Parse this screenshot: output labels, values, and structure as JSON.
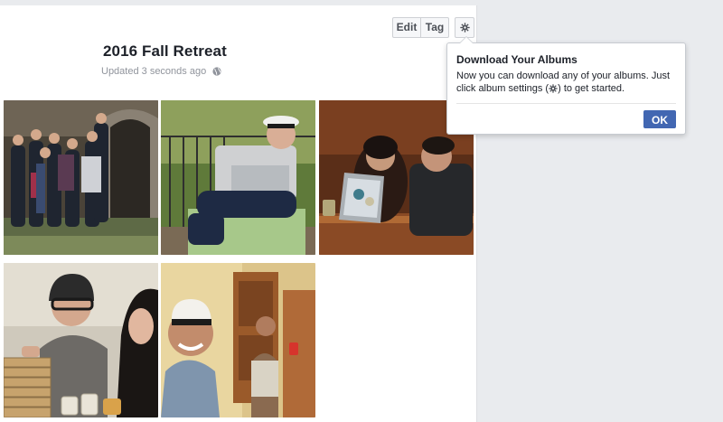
{
  "toolbar": {
    "edit_label": "Edit",
    "tag_label": "Tag",
    "settings_icon": "gear-icon"
  },
  "album": {
    "title": "2016 Fall Retreat",
    "updated": "Updated 3 seconds ago",
    "privacy_icon": "globe-icon"
  },
  "photos": [
    {
      "scene": "group-posing-outdoors"
    },
    {
      "scene": "man-in-captain-hat-with-laptop"
    },
    {
      "scene": "two-people-looking-at-laptop"
    },
    {
      "scene": "man-in-beanie-playing-jenga"
    },
    {
      "scene": "man-in-captain-hat-smiling"
    }
  ],
  "popover": {
    "title": "Download Your Albums",
    "body_line1": "Now you can download any of your albums. Just",
    "body_line2_pre": "click album settings (",
    "body_line2_post": ") to get started.",
    "ok_label": "OK"
  },
  "colors": {
    "page_bg": "#e9ebee",
    "primary_button": "#4267b2",
    "meta_text": "#90949c"
  }
}
